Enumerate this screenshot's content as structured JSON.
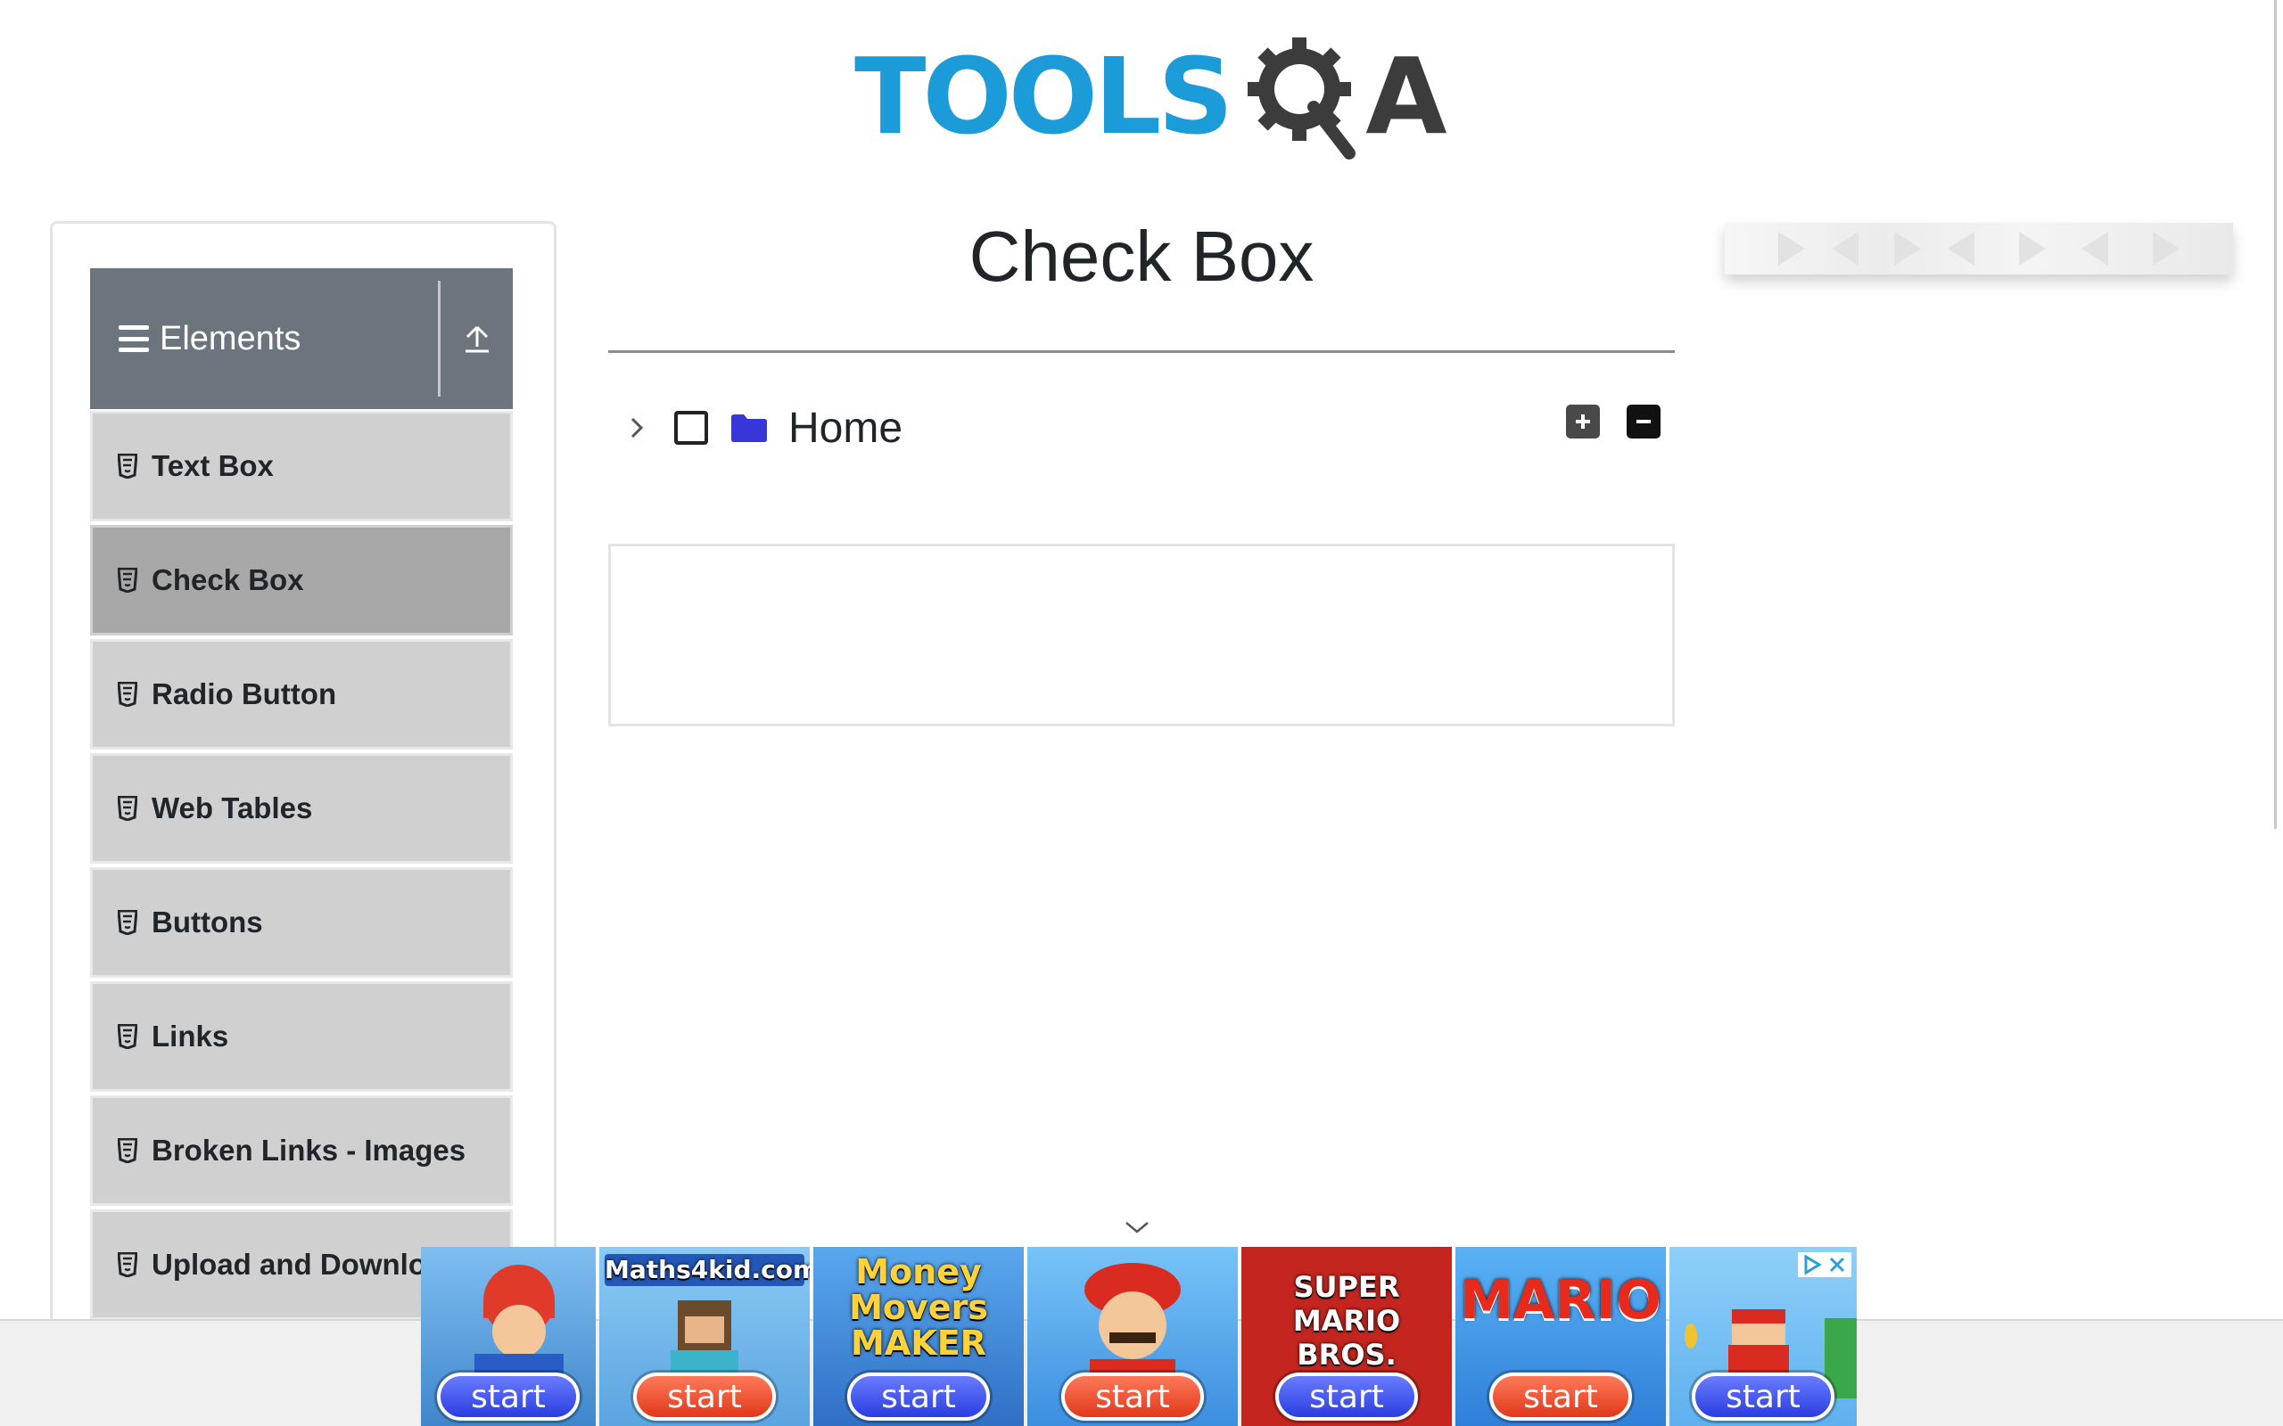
{
  "logo": {
    "part1": "TOOLS",
    "part2": "A"
  },
  "sidebar": {
    "group_title": "Elements",
    "items": [
      {
        "label": "Text Box",
        "active": false
      },
      {
        "label": "Check Box",
        "active": true
      },
      {
        "label": "Radio Button",
        "active": false
      },
      {
        "label": "Web Tables",
        "active": false
      },
      {
        "label": "Buttons",
        "active": false
      },
      {
        "label": "Links",
        "active": false
      },
      {
        "label": "Broken Links - Images",
        "active": false
      },
      {
        "label": "Upload and Download",
        "active": false
      }
    ]
  },
  "main": {
    "title": "Check Box",
    "tree": {
      "root_label": "Home",
      "checked": false,
      "expanded": false
    }
  },
  "ads": {
    "tiles": [
      {
        "caption": "",
        "button": "start",
        "style": "blue",
        "bg": "#5b9bd8"
      },
      {
        "caption": "Maths4kid.com",
        "button": "start",
        "style": "red",
        "bg": "#6bb0e6"
      },
      {
        "caption": "Money Movers MAKER",
        "button": "start",
        "style": "blue",
        "bg": "#3f7bd0"
      },
      {
        "caption": "",
        "button": "start",
        "style": "red",
        "bg": "#4aa0e8"
      },
      {
        "caption": "SUPER MARIO BROS.",
        "button": "start",
        "style": "blue",
        "bg": "#c4261f"
      },
      {
        "caption": "MARIO",
        "button": "start",
        "style": "red",
        "bg": "#2f86e0"
      },
      {
        "caption": "",
        "button": "start",
        "style": "blue",
        "bg": "#5ab0f0"
      }
    ]
  },
  "colors": {
    "sidebar_header": "#6c757d",
    "menu_item": "#d0d0d0",
    "menu_item_active": "#a8a8a8",
    "logo_blue": "#1b9bd7",
    "folder": "#3636d9"
  }
}
